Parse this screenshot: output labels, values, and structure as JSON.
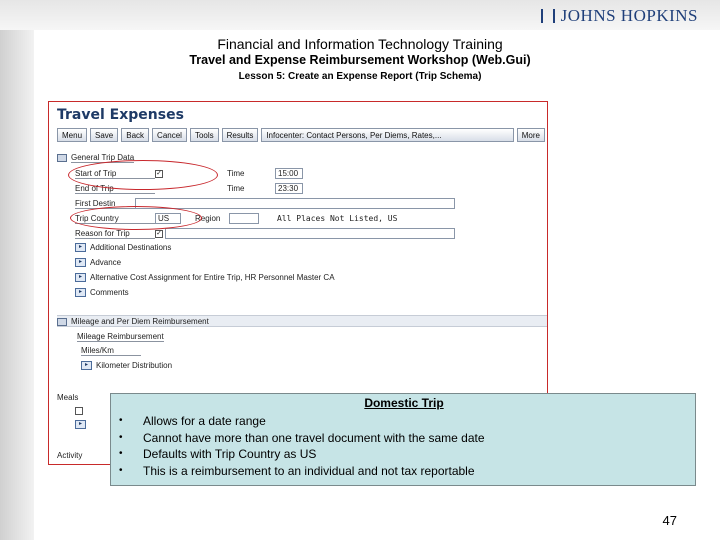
{
  "header": {
    "logo": "JOHNS HOPKINS",
    "title1": "Financial and Information Technology Training",
    "title2": "Travel and Expense Reimbursement Workshop (Web.Gui)",
    "title3": "Lesson 5: Create an Expense Report (Trip Schema)"
  },
  "sap": {
    "title": "Travel Expenses",
    "toolbar": [
      "Menu",
      "Save",
      "Back",
      "Cancel",
      "Tools",
      "Results",
      "Infocenter: Contact Persons, Per Diems, Rates,...",
      "More"
    ],
    "general_section": "General Trip Data",
    "fields": {
      "start_label": "Start of Trip",
      "end_label": "End of Trip",
      "time_label": "Time",
      "start_time": "15:00",
      "end_time": "23:30",
      "first_dest_label": "First Destin",
      "country_label": "Trip Country",
      "country_value": "US",
      "region_label": "Region",
      "region_text": "All Places Not Listed, US",
      "reason_label": "Reason for Trip"
    },
    "items": [
      "Additional Destinations",
      "Advance",
      "Alternative Cost Assignment for Entire Trip, HR Personnel Master CA",
      "Comments"
    ],
    "mileage_section": "Mileage and Per Diem Reimbursement",
    "mileage_sub": "Mileage Reimbursement",
    "miles_label": "Miles/Km",
    "mileage_item": "Kilometer Distribution",
    "meals_label": "Meals",
    "activity_label": "Activity"
  },
  "callout": {
    "title": "Domestic Trip",
    "bullets": [
      "Allows for a date range",
      "Cannot have more than one travel document with the same date",
      "Defaults with Trip Country as US",
      "This is a reimbursement to an individual and not tax reportable"
    ]
  },
  "page_number": "47"
}
